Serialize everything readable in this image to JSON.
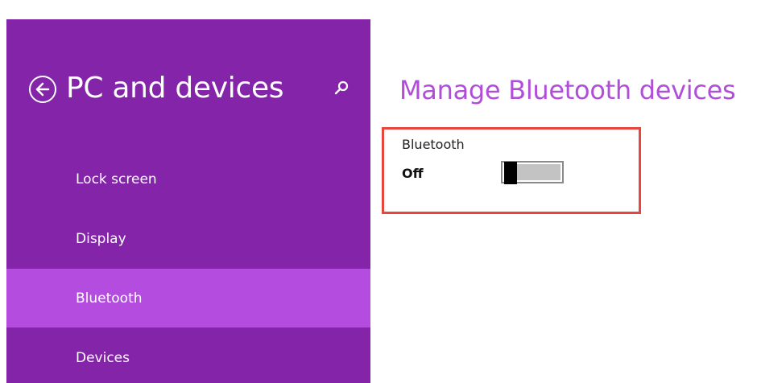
{
  "sidebar": {
    "title": "PC and devices",
    "back_icon": "back-arrow-circle-icon",
    "search_icon": "search-icon",
    "items": [
      {
        "label": "Lock screen",
        "selected": false
      },
      {
        "label": "Display",
        "selected": false
      },
      {
        "label": "Bluetooth",
        "selected": true
      },
      {
        "label": "Devices",
        "selected": false
      }
    ]
  },
  "main": {
    "title": "Manage Bluetooth devices",
    "bluetooth": {
      "label": "Bluetooth",
      "state": "Off",
      "enabled": false
    }
  },
  "colors": {
    "sidebar": "#8424a9",
    "selected_item": "#b44ce0",
    "title_accent": "#b14ed8",
    "highlight_border": "#e8453f"
  }
}
